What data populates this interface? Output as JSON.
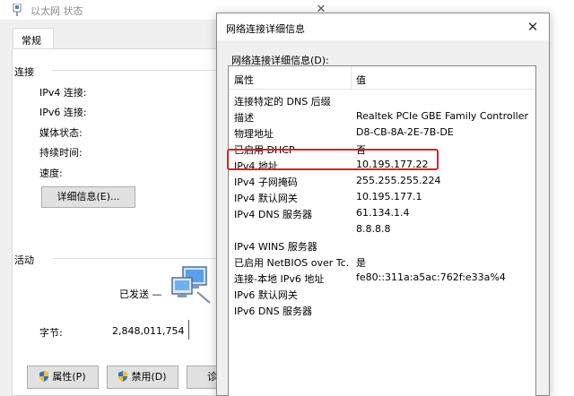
{
  "status_window": {
    "title": "以太网 状态",
    "close_glyph": "✕",
    "tab_general": "常规",
    "connection_group": "连接",
    "conn_labels": [
      "IPv4 连接:",
      "IPv6 连接:",
      "媒体状态:",
      "持续时间:",
      "速度:"
    ],
    "details_button": "详细信息(E)...",
    "activity_group": "活动",
    "sent_label": "已发送 —",
    "bytes_label": "字节:",
    "bytes_sent": "2,848,011,754",
    "properties_button": "属性(P)",
    "disable_button": "禁用(D)",
    "diagnose_button": "诊"
  },
  "details_dialog": {
    "title": "网络连接详细信息",
    "close_glyph": "✕",
    "list_caption": "网络连接详细信息(D):",
    "col_property": "属性",
    "col_value": "值",
    "rows": [
      {
        "k": "连接特定的 DNS 后缀",
        "v": ""
      },
      {
        "k": "描述",
        "v": "Realtek PCIe GBE Family Controller"
      },
      {
        "k": "物理地址",
        "v": "D8-CB-8A-2E-7B-DE"
      },
      {
        "k": "已启用 DHCP",
        "v": "否"
      },
      {
        "k": "IPv4 地址",
        "v": "10.195.177.22"
      },
      {
        "k": "IPv4 子网掩码",
        "v": "255.255.255.224"
      },
      {
        "k": "IPv4 默认网关",
        "v": "10.195.177.1"
      },
      {
        "k": "IPv4 DNS 服务器",
        "v": "61.134.1.4"
      },
      {
        "k": "",
        "v": "8.8.8.8"
      },
      {
        "k": "IPv4 WINS 服务器",
        "v": ""
      },
      {
        "k": "已启用 NetBIOS over Tc...",
        "v": "是"
      },
      {
        "k": "连接-本地 IPv6 地址",
        "v": "fe80::311a:a5ac:762f:e33a%4"
      },
      {
        "k": "IPv6 默认网关",
        "v": ""
      },
      {
        "k": "IPv6 DNS 服务器",
        "v": ""
      }
    ]
  },
  "colors": {
    "highlight": "#e02020",
    "window_bg": "#f0f0f0",
    "button_bg": "#e1e1e1"
  }
}
